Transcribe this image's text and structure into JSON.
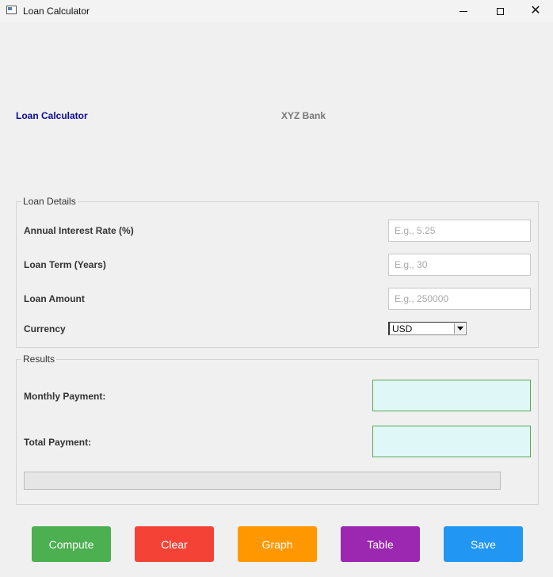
{
  "window": {
    "title": "Loan Calculator",
    "minimize_icon": "minimize-icon",
    "maximize_icon": "maximize-icon",
    "close_icon": "close-icon"
  },
  "header": {
    "title": "Loan Calculator",
    "bank": "XYZ Bank",
    "title_color": "#0a0a96",
    "bank_color": "#777777"
  },
  "loan_details": {
    "legend": "Loan Details",
    "interest_rate": {
      "label": "Annual Interest Rate (%)",
      "value": "",
      "placeholder": "E.g., 5.25"
    },
    "loan_term": {
      "label": "Loan Term (Years)",
      "value": "",
      "placeholder": "E.g., 30"
    },
    "loan_amount": {
      "label": "Loan Amount",
      "value": "",
      "placeholder": "E.g., 250000"
    },
    "currency": {
      "label": "Currency",
      "selected": "USD"
    }
  },
  "results": {
    "legend": "Results",
    "monthly_payment": {
      "label": "Monthly Payment:",
      "value": ""
    },
    "total_payment": {
      "label": "Total Payment:",
      "value": ""
    },
    "progress_percent": 0
  },
  "buttons": {
    "compute": {
      "label": "Compute",
      "color": "#4caf50"
    },
    "clear": {
      "label": "Clear",
      "color": "#f44336"
    },
    "graph": {
      "label": "Graph",
      "color": "#ff9800"
    },
    "table": {
      "label": "Table",
      "color": "#9c27b0"
    },
    "save": {
      "label": "Save",
      "color": "#2196f3"
    }
  }
}
